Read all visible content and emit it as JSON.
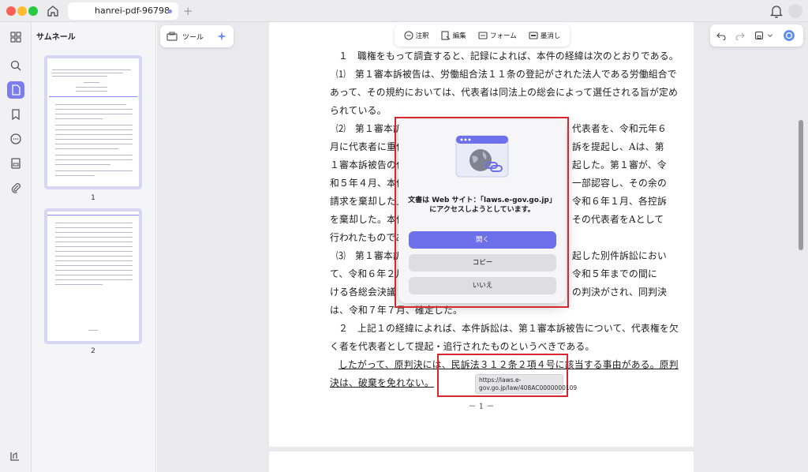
{
  "window": {
    "tab_title": "hanrei-pdf-96798",
    "new_tab_symbol": "+"
  },
  "sidebar": {
    "title": "サムネール",
    "thumbnails": [
      {
        "label": "1"
      },
      {
        "label": "2"
      }
    ]
  },
  "tool_pill": {
    "label": "ツール"
  },
  "center_toolbar": {
    "items": [
      {
        "label": "注釈",
        "icon": "comment-icon"
      },
      {
        "label": "編集",
        "icon": "edit-icon"
      },
      {
        "label": "フォーム",
        "icon": "form-icon"
      },
      {
        "label": "墨消し",
        "icon": "redact-icon"
      }
    ]
  },
  "document": {
    "lines": [
      "１　職権をもって調査すると、記録によれば、本件の経緯は次のとおりである。",
      "⑴　第１審本訴被告は、労働組合法１１条の登記がされた法人である労働組合で",
      "あって、その規約においては、代表者は同法上の総会によって選任される旨が定め",
      "られている。",
      "⑵　第１審本訴",
      "月に代表者に重任",
      "１審本訴被告の代",
      "和５年４月、本件",
      "請求を棄却した上",
      "を棄却した。本件",
      "行われたものであ",
      "⑶　第１審本訴",
      "て、令和６年２月",
      "ける各総会決議",
      "は、令和７年７月、確定した。",
      "２　上記１の経緯によれば、本件訴訟は、第１審本訴被告について、代表権を欠",
      "く者を代表者として提起・追行されたものというべきである。",
      "したがって、原判決には、民訴法３１２条２項４号に該当する事由がある。原判",
      "決は、破棄を免れない。"
    ],
    "right_fragments": [
      "代表者を、令和元年６",
      "訴を提起し、Aは、第",
      "起した。第１審が、令",
      "一部認容し、その余の",
      "令和６年１月、各控訴",
      "その代表者をAとして",
      "起した別件訴訟におい",
      "令和５年までの間に",
      "の判決がされ、同判決"
    ],
    "page_number": "－ 1 －"
  },
  "dialog": {
    "message": "文書は Web サイト：「laws.e-gov.go.jp」にアクセスしようとしています。",
    "open_label": "開く",
    "copy_label": "コピー",
    "no_label": "いいえ",
    "accent": "#6e6fea"
  },
  "tooltip": {
    "url": "https://laws.e-gov.go.jp/law/408AC0000000109"
  },
  "colors": {
    "highlight_frame": "#d8262f",
    "accent": "#7b7cf0"
  }
}
